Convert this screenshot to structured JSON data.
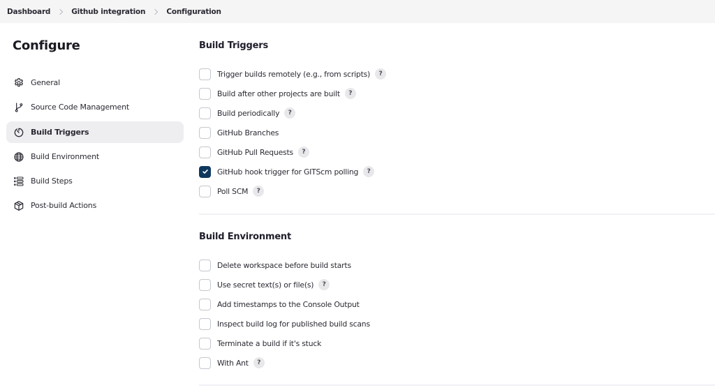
{
  "breadcrumb": [
    "Dashboard",
    "Github integration",
    "Configuration"
  ],
  "sidebar": {
    "title": "Configure",
    "items": [
      {
        "label": "General",
        "icon": "gear-icon",
        "active": false
      },
      {
        "label": "Source Code Management",
        "icon": "git-branch-icon",
        "active": false
      },
      {
        "label": "Build Triggers",
        "icon": "timer-icon",
        "active": true
      },
      {
        "label": "Build Environment",
        "icon": "globe-icon",
        "active": false
      },
      {
        "label": "Build Steps",
        "icon": "list-icon",
        "active": false
      },
      {
        "label": "Post-build Actions",
        "icon": "package-icon",
        "active": false
      }
    ]
  },
  "build_triggers": {
    "title": "Build Triggers",
    "options": [
      {
        "label": "Trigger builds remotely (e.g., from scripts)",
        "checked": false,
        "help": true
      },
      {
        "label": "Build after other projects are built",
        "checked": false,
        "help": true
      },
      {
        "label": "Build periodically",
        "checked": false,
        "help": true
      },
      {
        "label": "GitHub Branches",
        "checked": false,
        "help": false
      },
      {
        "label": "GitHub Pull Requests",
        "checked": false,
        "help": true
      },
      {
        "label": "GitHub hook trigger for GITScm polling",
        "checked": true,
        "help": true
      },
      {
        "label": "Poll SCM",
        "checked": false,
        "help": true
      }
    ]
  },
  "build_environment": {
    "title": "Build Environment",
    "options": [
      {
        "label": "Delete workspace before build starts",
        "checked": false,
        "help": false
      },
      {
        "label": "Use secret text(s) or file(s)",
        "checked": false,
        "help": true
      },
      {
        "label": "Add timestamps to the Console Output",
        "checked": false,
        "help": false
      },
      {
        "label": "Inspect build log for published build scans",
        "checked": false,
        "help": false
      },
      {
        "label": "Terminate a build if it's stuck",
        "checked": false,
        "help": false
      },
      {
        "label": "With Ant",
        "checked": false,
        "help": true
      }
    ]
  },
  "help_glyph": "?",
  "colors": {
    "checkbox_checked": "#10385e",
    "active_item_bg": "#eeeef1",
    "topbar_bg": "#f5f5f6"
  }
}
